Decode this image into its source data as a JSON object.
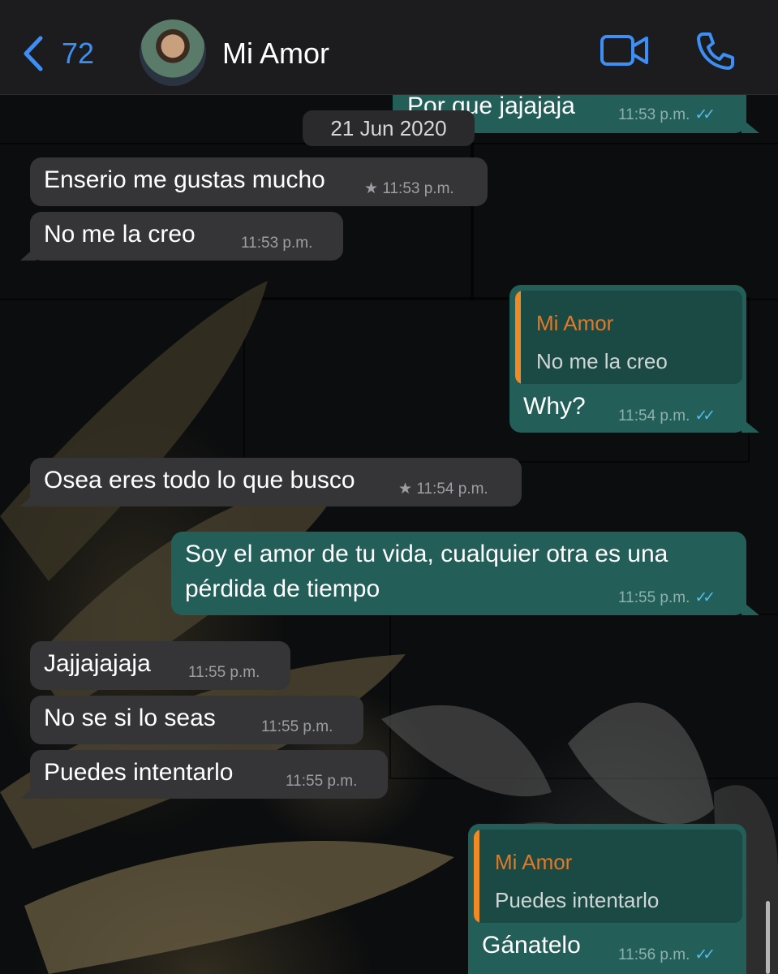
{
  "header": {
    "back_count": "72",
    "contact_name": "Mi Amor"
  },
  "date_separator": "21 Jun 2020",
  "messages": [
    {
      "dir": "out",
      "text": "Por que jajajaja",
      "time": "11:53 p.m.",
      "ticks": "✓✓"
    },
    {
      "dir": "in",
      "text": "Enserio me gustas mucho",
      "time": "11:53 p.m.",
      "star": "★"
    },
    {
      "dir": "in",
      "text": "No me la creo",
      "time": "11:53 p.m."
    },
    {
      "dir": "out",
      "reply_to": {
        "name": "Mi Amor",
        "text": "No me la creo"
      },
      "text": "Why?",
      "time": "11:54 p.m.",
      "ticks": "✓✓"
    },
    {
      "dir": "in",
      "text": "Osea eres todo lo que busco",
      "time": "11:54 p.m.",
      "star": "★"
    },
    {
      "dir": "out",
      "text_line1": "Soy el amor de tu vida, cualquier otra es una",
      "text_line2": "pérdida de tiempo",
      "time": "11:55 p.m.",
      "ticks": "✓✓"
    },
    {
      "dir": "in",
      "text": "Jajjajajaja",
      "time": "11:55 p.m."
    },
    {
      "dir": "in",
      "text": "No se si lo seas",
      "time": "11:55 p.m."
    },
    {
      "dir": "in",
      "text": "Puedes intentarlo",
      "time": "11:55 p.m."
    },
    {
      "dir": "out",
      "reply_to": {
        "name": "Mi Amor",
        "text": "Puedes intentarlo"
      },
      "text": "Gánatelo",
      "time": "11:56 p.m.",
      "ticks": "✓✓"
    }
  ],
  "colors": {
    "header_bg": "#1c1c1e",
    "accent_blue": "#3d8ef5",
    "incoming_bubble": "#353537",
    "outgoing_bubble": "#235e58",
    "quote_bar": "#f08a24",
    "read_ticks": "#53bdeb"
  },
  "icons": [
    "chevron-left-icon",
    "video-camera-icon",
    "phone-icon",
    "star-icon",
    "double-check-icon"
  ]
}
